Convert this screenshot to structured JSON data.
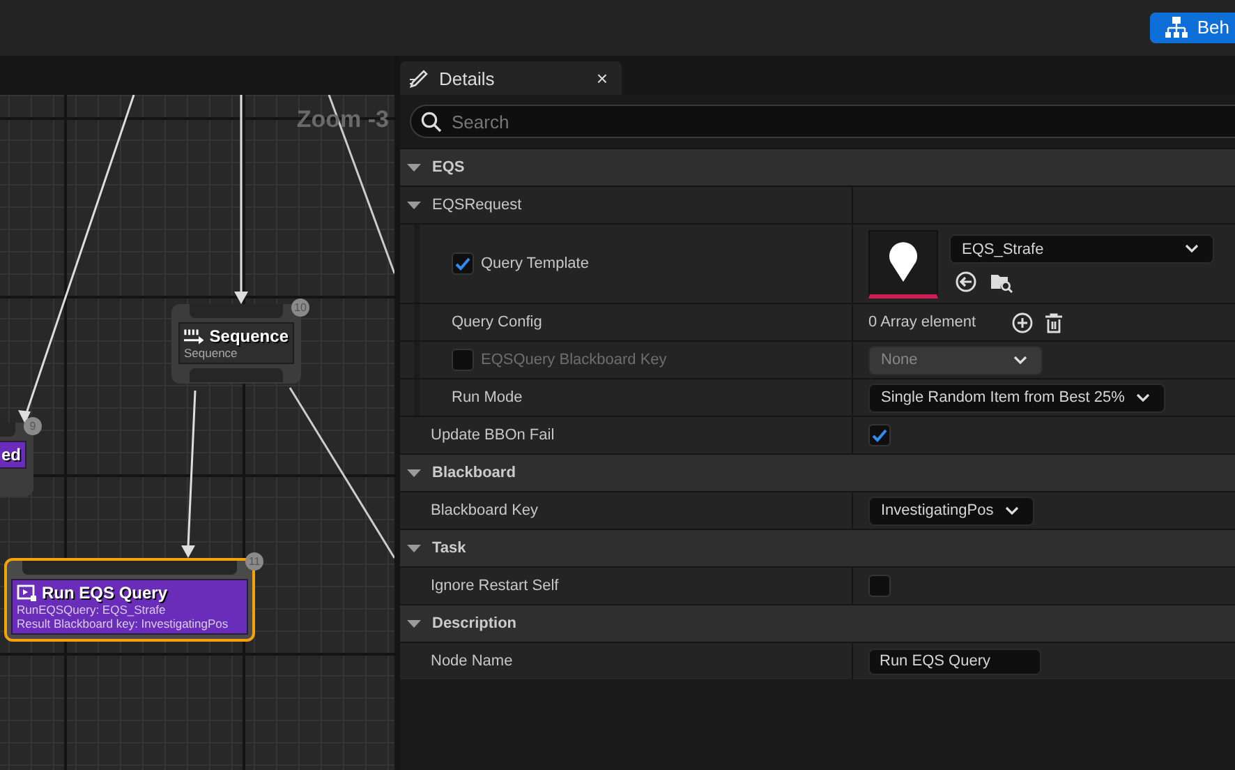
{
  "toolbar": {
    "button": "Beh"
  },
  "graph": {
    "zoom_label": "Zoom -3",
    "nodes": [
      {
        "kind": "composite",
        "title": "Sequence",
        "lines": [
          "Sequence"
        ],
        "badge": "10",
        "selected": false
      },
      {
        "kind": "task",
        "title": "ed",
        "badge": "9",
        "selected": false
      },
      {
        "kind": "task",
        "title": "Run EQS Query",
        "lines": [
          "RunEQSQuery: EQS_Strafe",
          "Result Blackboard key: InvestigatingPos"
        ],
        "badge": "11",
        "selected": true
      }
    ]
  },
  "details": {
    "tab": {
      "label": "Details",
      "close": "×"
    },
    "search": {
      "placeholder": "Search"
    },
    "sections": [
      {
        "title": "EQS",
        "expanded": true,
        "rows": [
          {
            "kind": "group",
            "label": "EQSRequest",
            "expanded": true,
            "children": [
              {
                "kind": "asset",
                "label": "Query Template",
                "toggle": true,
                "value": "EQS_Strafe"
              },
              {
                "kind": "array",
                "label": "Query Config",
                "value": "0 Array element"
              },
              {
                "kind": "combo",
                "label": "EQSQuery Blackboard Key",
                "toggle": false,
                "disabled": true,
                "value": "None"
              },
              {
                "kind": "combo",
                "label": "Run Mode",
                "disabled": false,
                "value": "Single Random Item from Best 25%"
              }
            ]
          },
          {
            "kind": "checkbox",
            "label": "Update BBOn Fail",
            "checked": true
          }
        ]
      },
      {
        "title": "Blackboard",
        "expanded": true,
        "rows": [
          {
            "kind": "combo",
            "label": "Blackboard Key",
            "disabled": false,
            "value": "InvestigatingPos"
          }
        ]
      },
      {
        "title": "Task",
        "expanded": true,
        "rows": [
          {
            "kind": "checkbox",
            "label": "Ignore Restart Self",
            "checked": false
          }
        ]
      },
      {
        "title": "Description",
        "expanded": true,
        "rows": [
          {
            "kind": "text",
            "label": "Node Name",
            "value": "Run EQS Query"
          }
        ]
      }
    ]
  }
}
